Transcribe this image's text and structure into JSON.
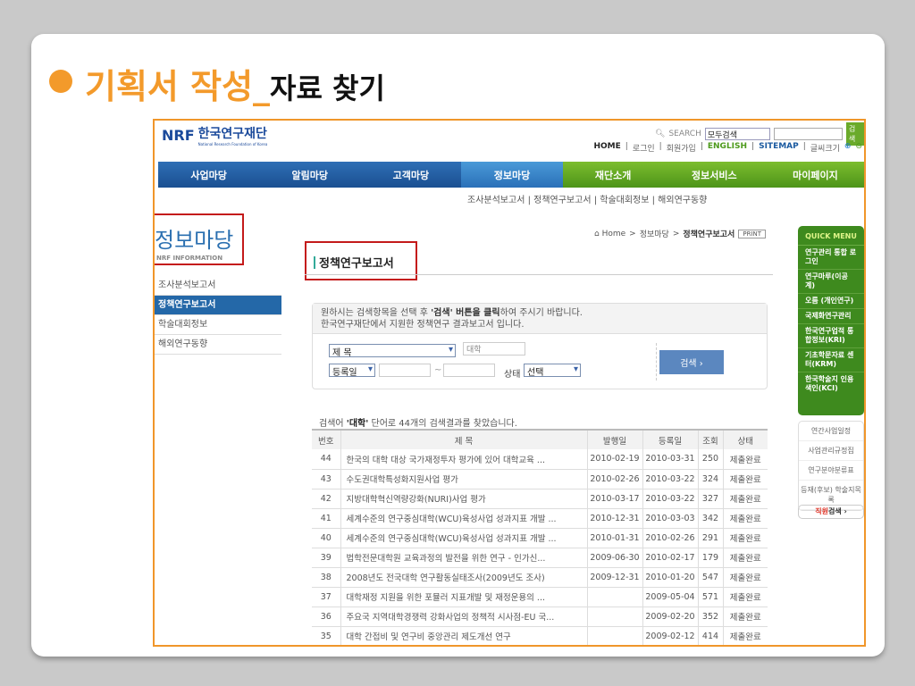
{
  "slide": {
    "bullet_title": "기획서 작성_",
    "sub_title": "자료 찾기"
  },
  "header": {
    "logo_abbr": "NRF",
    "logo_name": "한국연구재단",
    "logo_en": "National Research Foundation of Korea",
    "search_label": "SEARCH",
    "search_scope": "모두검색",
    "search_button": "검색",
    "util": [
      "HOME",
      "로그인",
      "회원가입",
      "ENGLISH",
      "SITEMAP",
      "글씨크기"
    ]
  },
  "nav": [
    "사업마당",
    "알림마당",
    "고객마당",
    "정보마당",
    "재단소개",
    "정보서비스",
    "마이페이지"
  ],
  "subnav": "조사분석보고서 | 정책연구보고서 | 학술대회정보 | 해외연구동향",
  "sidebar": {
    "title": "정보마당",
    "subtitle": "NRF INFORMATION",
    "items": [
      "조사분석보고서",
      "정책연구보고서",
      "학술대회정보",
      "해외연구동향"
    ]
  },
  "breadcrumb": {
    "home": "⌂ Home",
    "sep1": ">",
    "level1": "정보마당",
    "sep2": ">",
    "current": "정책연구보고서",
    "print": "PRINT"
  },
  "page_title": "정책연구보고서",
  "search": {
    "intro1_a": "원하시는 검색항목을 선택 후 ",
    "intro1_b": "'검색' 버튼을 클릭",
    "intro1_c": "하여 주시기 바랍니다.",
    "intro2": "한국연구재단에서 지원한 정책연구 결과보고서 입니다.",
    "field": "제 목",
    "keyword": "대학",
    "date_type": "등록일",
    "tilde": "~",
    "status_label": "상태",
    "status": "선택",
    "button": "검색 ›"
  },
  "result_a": "검색어 ",
  "result_b": "'대학'",
  "result_c": " 단어로 44개의 검색결과를 찾았습니다.",
  "table": {
    "headers": [
      "번호",
      "제 목",
      "발행일",
      "등록일",
      "조회",
      "상태"
    ],
    "rows": [
      [
        "44",
        "한국의 대학 대상 국가재정투자 평가에 있어 대학교육 ...",
        "2010-02-19",
        "2010-03-31",
        "250",
        "제출완료"
      ],
      [
        "43",
        "수도권대학특성화지원사업 평가",
        "2010-02-26",
        "2010-03-22",
        "324",
        "제출완료"
      ],
      [
        "42",
        "지방대학혁신역량강화(NURI)사업 평가",
        "2010-03-17",
        "2010-03-22",
        "327",
        "제출완료"
      ],
      [
        "41",
        "세계수준의 연구중심대학(WCU)육성사업 성과지표 개발 ...",
        "2010-12-31",
        "2010-03-03",
        "342",
        "제출완료"
      ],
      [
        "40",
        "세계수준의 연구중심대학(WCU)육성사업 성과지표 개발 ...",
        "2010-01-31",
        "2010-02-26",
        "291",
        "제출완료"
      ],
      [
        "39",
        "법학전문대학원 교육과정의 발전을 위한 연구 - 인가신...",
        "2009-06-30",
        "2010-02-17",
        "179",
        "제출완료"
      ],
      [
        "38",
        "2008년도 전국대학 연구활동실태조사(2009년도 조사)",
        "2009-12-31",
        "2010-01-20",
        "547",
        "제출완료"
      ],
      [
        "37",
        "대학재정 지원을 위한 포뮬러 지표개발 및 재정운용의 ...",
        "",
        "2009-05-04",
        "571",
        "제출완료"
      ],
      [
        "36",
        "주요국 지역대학경쟁력 강화사업의 정책적 시사점-EU 국...",
        "",
        "2009-02-20",
        "352",
        "제출완료"
      ],
      [
        "35",
        "대학 간접비 및 연구비 중앙관리 제도개선 연구",
        "",
        "2009-02-12",
        "414",
        "제출완료"
      ]
    ]
  },
  "quick_menu": {
    "title": "QUICK MENU",
    "items": [
      "연구관리 통합 로그인",
      "연구마루(이공계)",
      "오름 (개인연구)",
      "국제화연구관리",
      "한국연구업적 통합정보(KRI)",
      "기초학문자료 센터(KRM)",
      "한국학술지 인용색인(KCI)"
    ],
    "links": [
      "연간사업일정",
      "사업관리규정집",
      "연구분야분류표",
      "등재(후보) 학술지목록"
    ],
    "staff_a": "직원",
    "staff_b": "검색 ›"
  }
}
